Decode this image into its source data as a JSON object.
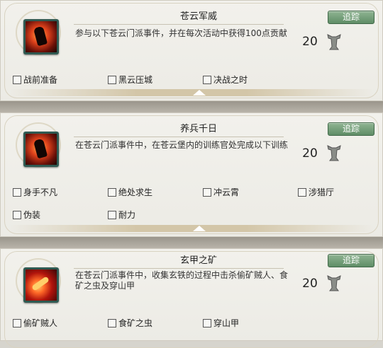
{
  "track_label": "追踪",
  "cards": [
    {
      "title": "苍云军威",
      "desc": "参与以下苍云门派事件，并在每次活动中获得100点贡献",
      "points": "20",
      "icon": "dark-red-warrior-icon",
      "objectives": [
        "战前准备",
        "黑云压城",
        "决战之时"
      ]
    },
    {
      "title": "养兵千日",
      "desc": "在苍云门派事件中，在苍云堡内的训练官处完成以下训练",
      "points": "20",
      "icon": "fire-warrior-icon",
      "objectives": [
        "身手不凡",
        "绝处求生",
        "冲云霄",
        "涉猎厅",
        "伪装",
        "耐力"
      ]
    },
    {
      "title": "玄甲之矿",
      "desc": "在苍云门派事件中，收集玄铁的过程中击杀偷矿贼人、食矿之虫及穿山甲",
      "points": "20",
      "icon": "fire-slash-icon",
      "objectives": [
        "偷矿贼人",
        "食矿之虫",
        "穿山甲"
      ]
    }
  ],
  "colors": {
    "track_button": "#6f9a74",
    "icon_border": "#2f5a52",
    "separator": "#a8a398"
  }
}
